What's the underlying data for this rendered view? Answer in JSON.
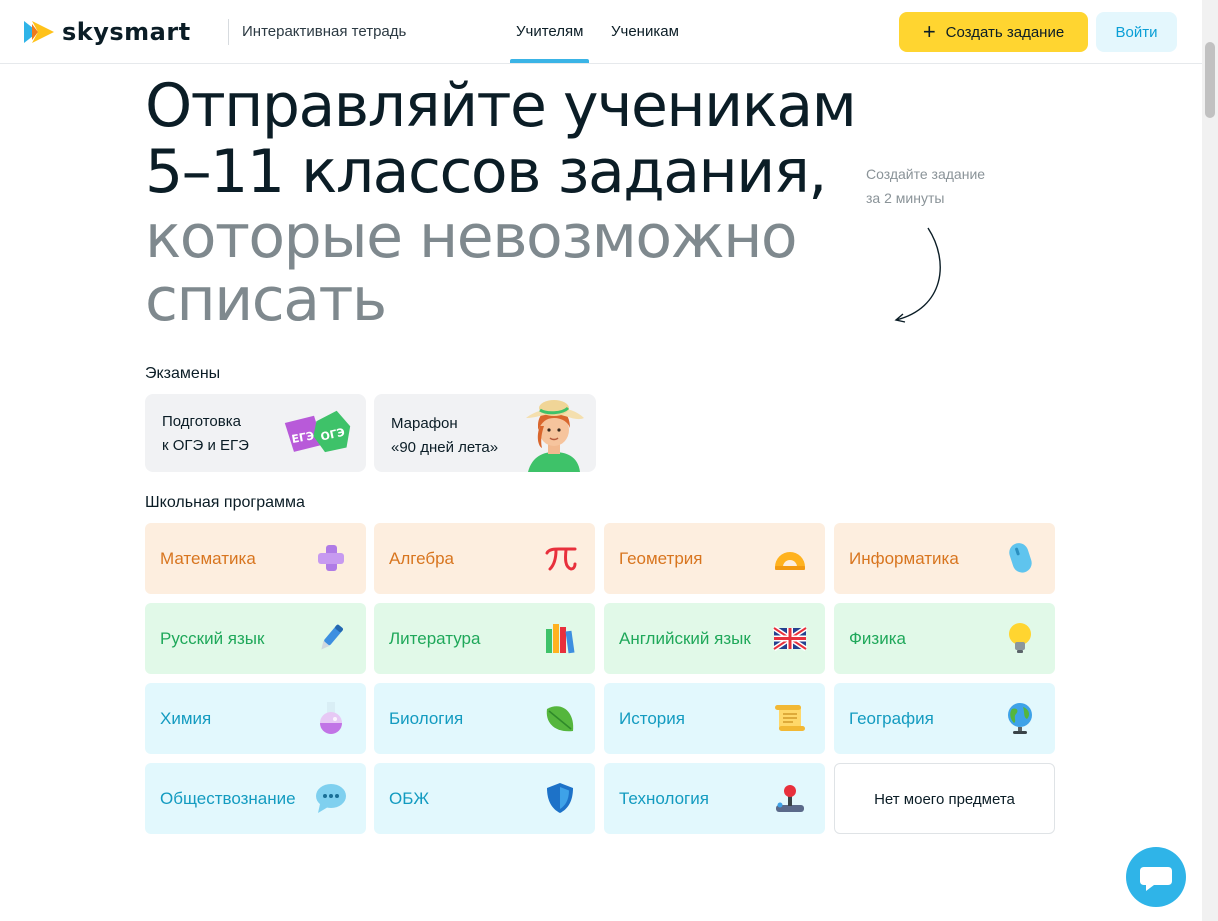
{
  "header": {
    "logo_text": "skysmart",
    "subtitle": "Интерактивная тетрадь",
    "tabs": [
      {
        "label": "Учителям",
        "active": true
      },
      {
        "label": "Ученикам",
        "active": false
      }
    ],
    "create_button": "Создать задание",
    "login_button": "Войти"
  },
  "hero": {
    "line1": "Отправляйте ученикам",
    "line2": "5–11 классов задания,",
    "line3": "которые невозможно",
    "line4": "списать",
    "hint_line1": "Создайте задание",
    "hint_line2": "за 2 минуты"
  },
  "exams": {
    "title": "Экзамены",
    "cards": [
      {
        "line1": "Подготовка",
        "line2": "к ОГЭ и ЕГЭ",
        "badge1": "ЕГЭ",
        "badge2": "ОГЭ"
      },
      {
        "line1": "Марафон",
        "line2": "«90 дней лета»"
      }
    ]
  },
  "school": {
    "title": "Школьная программа",
    "subjects": [
      {
        "label": "Математика",
        "icon": "plus-icon"
      },
      {
        "label": "Алгебра",
        "icon": "pi-icon"
      },
      {
        "label": "Геометрия",
        "icon": "protractor-icon"
      },
      {
        "label": "Информатика",
        "icon": "mouse-icon"
      },
      {
        "label": "Русский язык",
        "icon": "pen-icon"
      },
      {
        "label": "Литература",
        "icon": "books-icon"
      },
      {
        "label": "Английский язык",
        "icon": "uk-flag-icon"
      },
      {
        "label": "Физика",
        "icon": "bulb-icon"
      },
      {
        "label": "Химия",
        "icon": "flask-icon"
      },
      {
        "label": "Биология",
        "icon": "leaf-icon"
      },
      {
        "label": "История",
        "icon": "scroll-icon"
      },
      {
        "label": "География",
        "icon": "globe-icon"
      },
      {
        "label": "Обществознание",
        "icon": "chat-bubble-icon"
      },
      {
        "label": "ОБЖ",
        "icon": "shield-icon"
      },
      {
        "label": "Технология",
        "icon": "joystick-icon"
      },
      {
        "label": "Нет моего предмета",
        "icon": ""
      }
    ]
  },
  "colors": {
    "accent_yellow": "#ffd530",
    "accent_blue": "#2fb4e8",
    "peach_bg": "#fdeedf",
    "peach_text": "#d8751f",
    "mint_bg": "#e1f9e8",
    "mint_text": "#1fa85a",
    "sky_bg": "#e2f8fd",
    "sky_text": "#139bc0"
  }
}
